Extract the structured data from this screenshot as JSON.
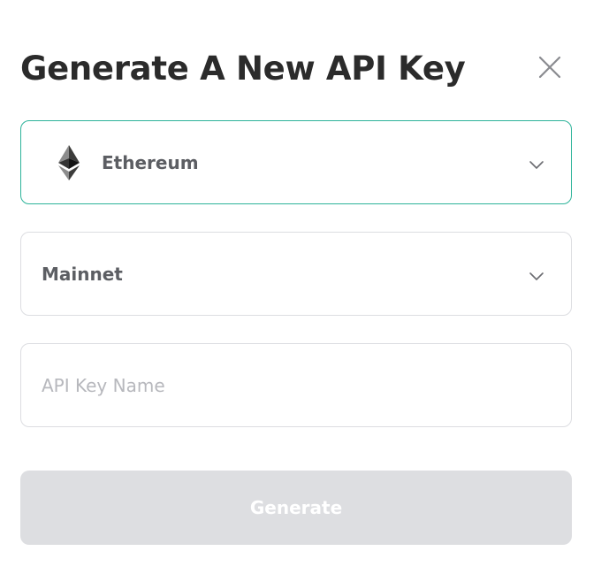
{
  "modal": {
    "title": "Generate A New API Key",
    "close_icon": "close-icon"
  },
  "chain_select": {
    "icon": "ethereum-icon",
    "selected": "Ethereum",
    "chevron_icon": "chevron-down-icon",
    "accent_color": "#2db39a"
  },
  "network_select": {
    "selected": "Mainnet",
    "chevron_icon": "chevron-down-icon"
  },
  "key_name_input": {
    "value": "",
    "placeholder": "API Key Name"
  },
  "generate_button": {
    "label": "Generate",
    "disabled": true,
    "background": "#dddee1"
  }
}
